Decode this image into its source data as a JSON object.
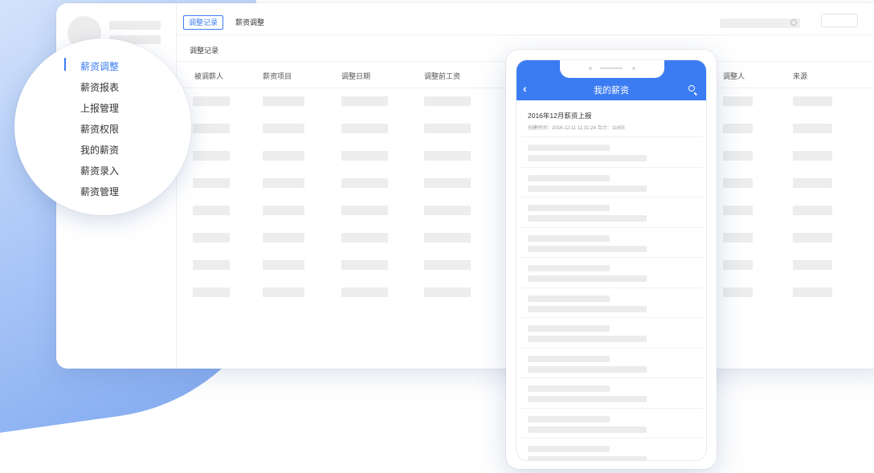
{
  "desktop": {
    "tabs": [
      {
        "label": "调整记录",
        "active": true
      },
      {
        "label": "薪资调整",
        "active": false
      }
    ],
    "subtitle": "调整记录",
    "table": {
      "columns": [
        "被调薪人",
        "薪资项目",
        "调整日期",
        "调整前工资",
        "调整人",
        "来源"
      ]
    }
  },
  "sidebar_zoom": {
    "items": [
      {
        "label": "薪资调整",
        "active": true
      },
      {
        "label": "薪资报表",
        "active": false
      },
      {
        "label": "上报管理",
        "active": false
      },
      {
        "label": "薪资权限",
        "active": false
      },
      {
        "label": "我的薪资",
        "active": false
      },
      {
        "label": "薪资录入",
        "active": false
      },
      {
        "label": "薪资管理",
        "active": false
      }
    ]
  },
  "phone": {
    "title": "我的薪资",
    "back_glyph": "‹",
    "first_item": {
      "title": "2016年12月薪资上报",
      "meta": "创建时间：2016-12-11 11:31:24   合计：11655"
    }
  },
  "colors": {
    "accent": "#3b7cf3",
    "placeholder": "#ececec"
  },
  "icons": {
    "phone_search": "search-icon",
    "desktop_search": "search-icon",
    "back": "chevron-left-icon"
  }
}
